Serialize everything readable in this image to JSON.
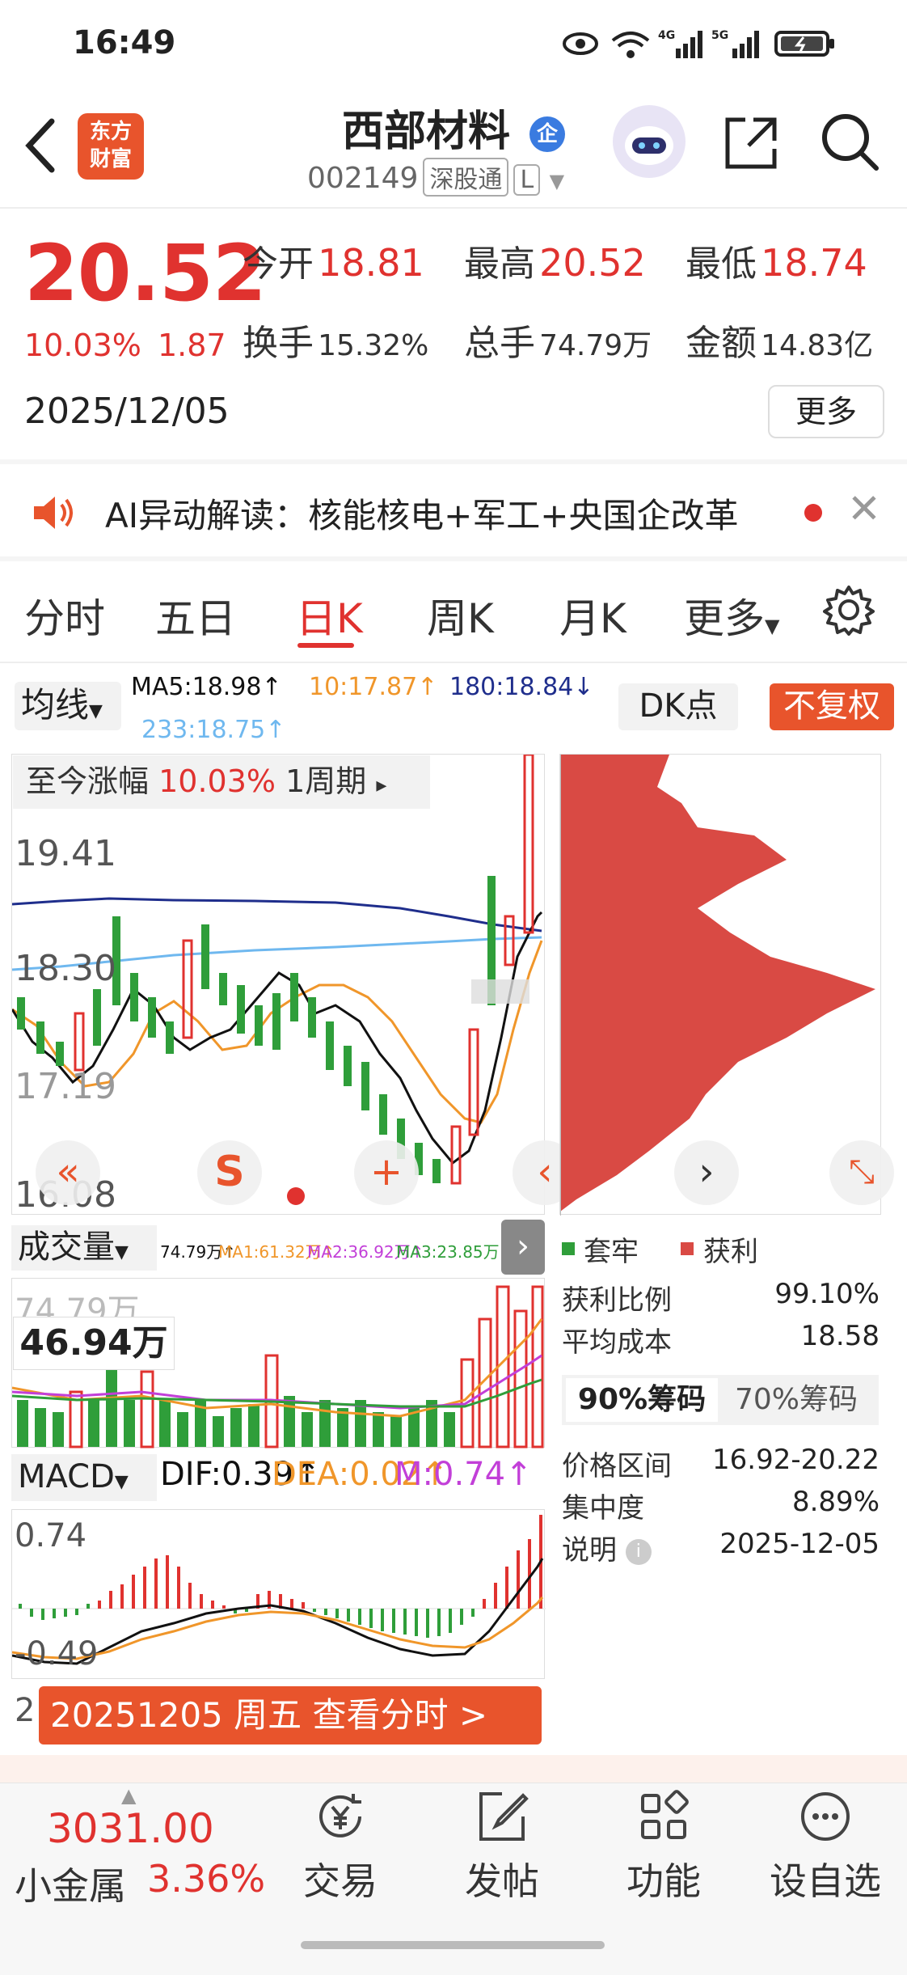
{
  "status_bar": {
    "time": "16:49",
    "net1": "6",
    "net2": "4G",
    "net3": "5G"
  },
  "header": {
    "title": "西部材料",
    "badge": "企",
    "code": "002149",
    "tag_sz": "深股通",
    "tag_l": "L",
    "logo_line1": "东方",
    "logo_line2": "财富"
  },
  "quote": {
    "price": "20.52",
    "change_pct": "10.03%",
    "change": "1.87",
    "date": "2025/12/05",
    "open_label": "今开",
    "open": "18.81",
    "high_label": "最高",
    "high": "20.52",
    "low_label": "最低",
    "low": "18.74",
    "turnover_label": "换手",
    "turnover": "15.32%",
    "volume_label": "总手",
    "volume": "74.79万",
    "amount_label": "金额",
    "amount": "14.83亿",
    "more": "更多"
  },
  "ai_banner": {
    "text": "AI异动解读：核能核电+军工+央国企改革"
  },
  "tabs": [
    "分时",
    "五日",
    "日K",
    "周K",
    "月K",
    "更多"
  ],
  "active_tab": 2,
  "chart": {
    "ma_select": "均线",
    "ma5": "MA5:18.98↑",
    "ma10": "10:17.87↑",
    "ma180": "180:18.84↓",
    "ma233": "233:18.75↑",
    "dk_button": "DK点",
    "fq_button": "不复权",
    "range_label": "至今涨幅",
    "range_pct": "10.03%",
    "range_period": "1周期",
    "y_top": "19.41",
    "y_mid": "18.30",
    "y_low": "16.08",
    "y_partial": "17.19"
  },
  "chip": {
    "legend_trapped": "套牢",
    "legend_profit": "获利",
    "profit_ratio_label": "获利比例",
    "profit_ratio": "99.10%",
    "avg_cost_label": "平均成本",
    "avg_cost": "18.58",
    "tab_90": "90%筹码",
    "tab_70": "70%筹码",
    "price_range_label": "价格区间",
    "price_range": "16.92-20.22",
    "concentration_label": "集中度",
    "concentration": "8.89%",
    "note_label": "说明",
    "note_date": "2025-12-05"
  },
  "volume": {
    "select": "成交量",
    "vol": "74.79万↑",
    "ma1": "MA1:61.32万↑",
    "ma2": "MA2:36.92万↑",
    "ma3": "MA3:23.85万↑",
    "top_label": "74.79万",
    "tip": "46.94万"
  },
  "macd": {
    "select": "MACD",
    "dif": "DIF:0.39↑",
    "dea": "DEA:0.02↑",
    "m": "M:0.74↑",
    "y_top": "0.74",
    "y_bottom": "-0.49",
    "banner": "20251205 周五 查看分时 >"
  },
  "bottom_nav": {
    "index_value": "3031.00",
    "index_name": "小金属",
    "index_pct": "3.36%",
    "items": [
      "交易",
      "发帖",
      "功能",
      "设自选"
    ]
  },
  "colors": {
    "up": "#e0322f",
    "down": "#2f9e3a",
    "accent": "#e8542c",
    "ma5": "#111111",
    "ma10": "#f0962a",
    "ma180": "#1f2e8c",
    "ma233": "#6fb8ef"
  }
}
